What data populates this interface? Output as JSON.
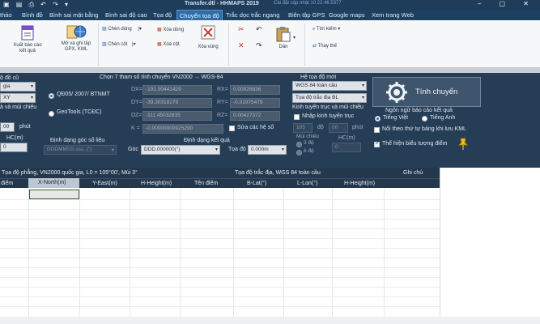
{
  "titlebar": {
    "title": "Transfer.dtl - HHMAPS   2019",
    "notice": "Cài đặt cập nhật 10.22.46.5377",
    "controls": "– ▢ ✕"
  },
  "menu": {
    "tabs": [
      "thảo",
      "Bình đồ",
      "Bình sai mặt bằng",
      "Bình sai độ cao",
      "Tọa độ",
      "Chuyển tọa độ",
      "Trắc dọc trắc ngang",
      "Biên tập GPS",
      "Google maps",
      "Xem trang Web"
    ],
    "active": "Chuyển tọa độ"
  },
  "ribbon": {
    "export_report": "Xuất báo cáo kết quả",
    "save_gps_kml": "Mở và ghi tệp GPX, KML",
    "insert_row": "Chèn dòng",
    "insert_col": "Chèn cột",
    "delete_row": "Xóa dòng",
    "delete_col": "Xóa cột",
    "delete_area": "Xóa vùng",
    "paste": "Dán",
    "find": "Tìm kiếm",
    "replace": "Thay thế"
  },
  "panel": {
    "old_coord_label": "ộ đồ cũ",
    "old_system_value": "gia",
    "xy_value": "XY",
    "meridian_label": "à và múi chiếu",
    "minutes_value": "00",
    "minutes_label": "phút",
    "hc_label": "HC(m)",
    "hc_value": "0",
    "param_title": "Chọn 7 tham số tính chuyển VN2000 → WGS-84",
    "radio_qd05": "QĐ05/ 2007/ BTNMT",
    "radio_geotools": "GeoTools (TCĐC)",
    "dx_label": "DX=",
    "dy_label": "DY=",
    "dz_label": "DZ=",
    "k_label": "K =",
    "rx_label": "RX=",
    "ry_label": "RY=",
    "rz_label": "RZ=",
    "dx_value": "-191.90441429",
    "dy_value": "-39.30318279",
    "dz_value": "-111.45032835",
    "k_value": "-0.00000000925290",
    "rx_value": "0.00928836",
    "ry_value": "-0.01975479",
    "rz_value": "0.00427372",
    "edit_params": "Sửa các hệ số",
    "new_coord_label": "Hệ tọa độ mới",
    "new_system_value": "WGS 84 toàn cầu",
    "new_type_value": "Tọa độ trắc địa BL",
    "meridian_new_label": "Kinh tuyến trục và múi chiếu",
    "input_meridian": "Nhập kinh tuyến trục",
    "deg_value": "105",
    "deg_label": "độ",
    "min_value": "00",
    "min_label": "phút",
    "zone_label": "Múi chiếu",
    "zone3": "3 độ",
    "zone6": "6 độ",
    "hc_new_label": "HC(m)",
    "hc_new_value": "0",
    "angle_format_label": "Định dạng góc số liệu",
    "angle_format_value": "DDDMMSS.sss..(\")",
    "result_format_label": "Định dạng kết quả",
    "result_angle_label": "Góc",
    "result_angle_value": "DDD.000000(°)",
    "result_coord_label": "Tọa độ",
    "result_coord_value": "0.000m",
    "convert_button": "Tính chuyển",
    "report_lang_label": "Ngôn ngữ báo cáo kết quả",
    "lang_vi": "Tiếng Việt",
    "lang_en": "Tiếng Anh",
    "kml_order": "Nối theo thứ tự bảng khi lưu KML",
    "show_symbol": "Thể hiện biểu tượng điểm"
  },
  "grid": {
    "group_left": "Tọa độ phẳng, VN2000 quốc gia, L0  = 105°00', Múi 3°",
    "group_right": "Tọa độ trắc địa, WGS 84 toàn cầu",
    "notes": "Ghi chú",
    "columns": [
      "điểm",
      "X-North(m)",
      "Y-East(m)",
      "H-Height(m)",
      "Tên điểm",
      "B-Lat(°)",
      "L-Lon(°)",
      "H-Height(m)"
    ]
  },
  "colors": {
    "panel_bg": "#263d56",
    "menu_bg": "#1d3f60",
    "active_tab": "#2e6da8",
    "grid_header": "#24384d"
  }
}
